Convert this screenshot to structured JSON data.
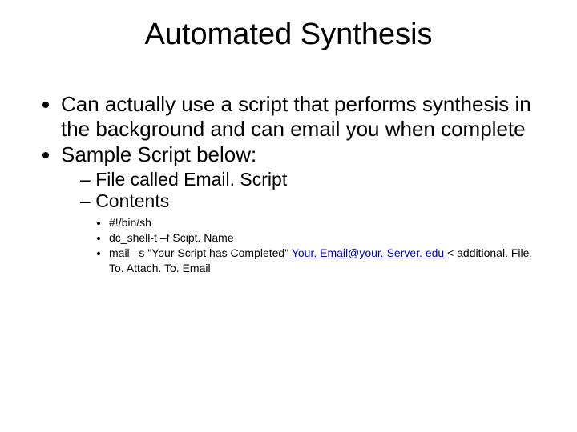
{
  "title": "Automated Synthesis",
  "bullets": {
    "b1": "Can actually use a script that performs synthesis in the background and can email you when complete",
    "b2": "Sample Script below:",
    "sub1": "File called Email. Script",
    "sub2": "Contents",
    "code1": "#!/bin/sh",
    "code2": "dc_shell-t –f Scipt. Name",
    "code3_pre": "mail –s \"Your Script has Completed\" ",
    "code3_link": "Your. Email@your. Server. edu ",
    "code3_post": "< additional. File. To. Attach. To. Email"
  }
}
